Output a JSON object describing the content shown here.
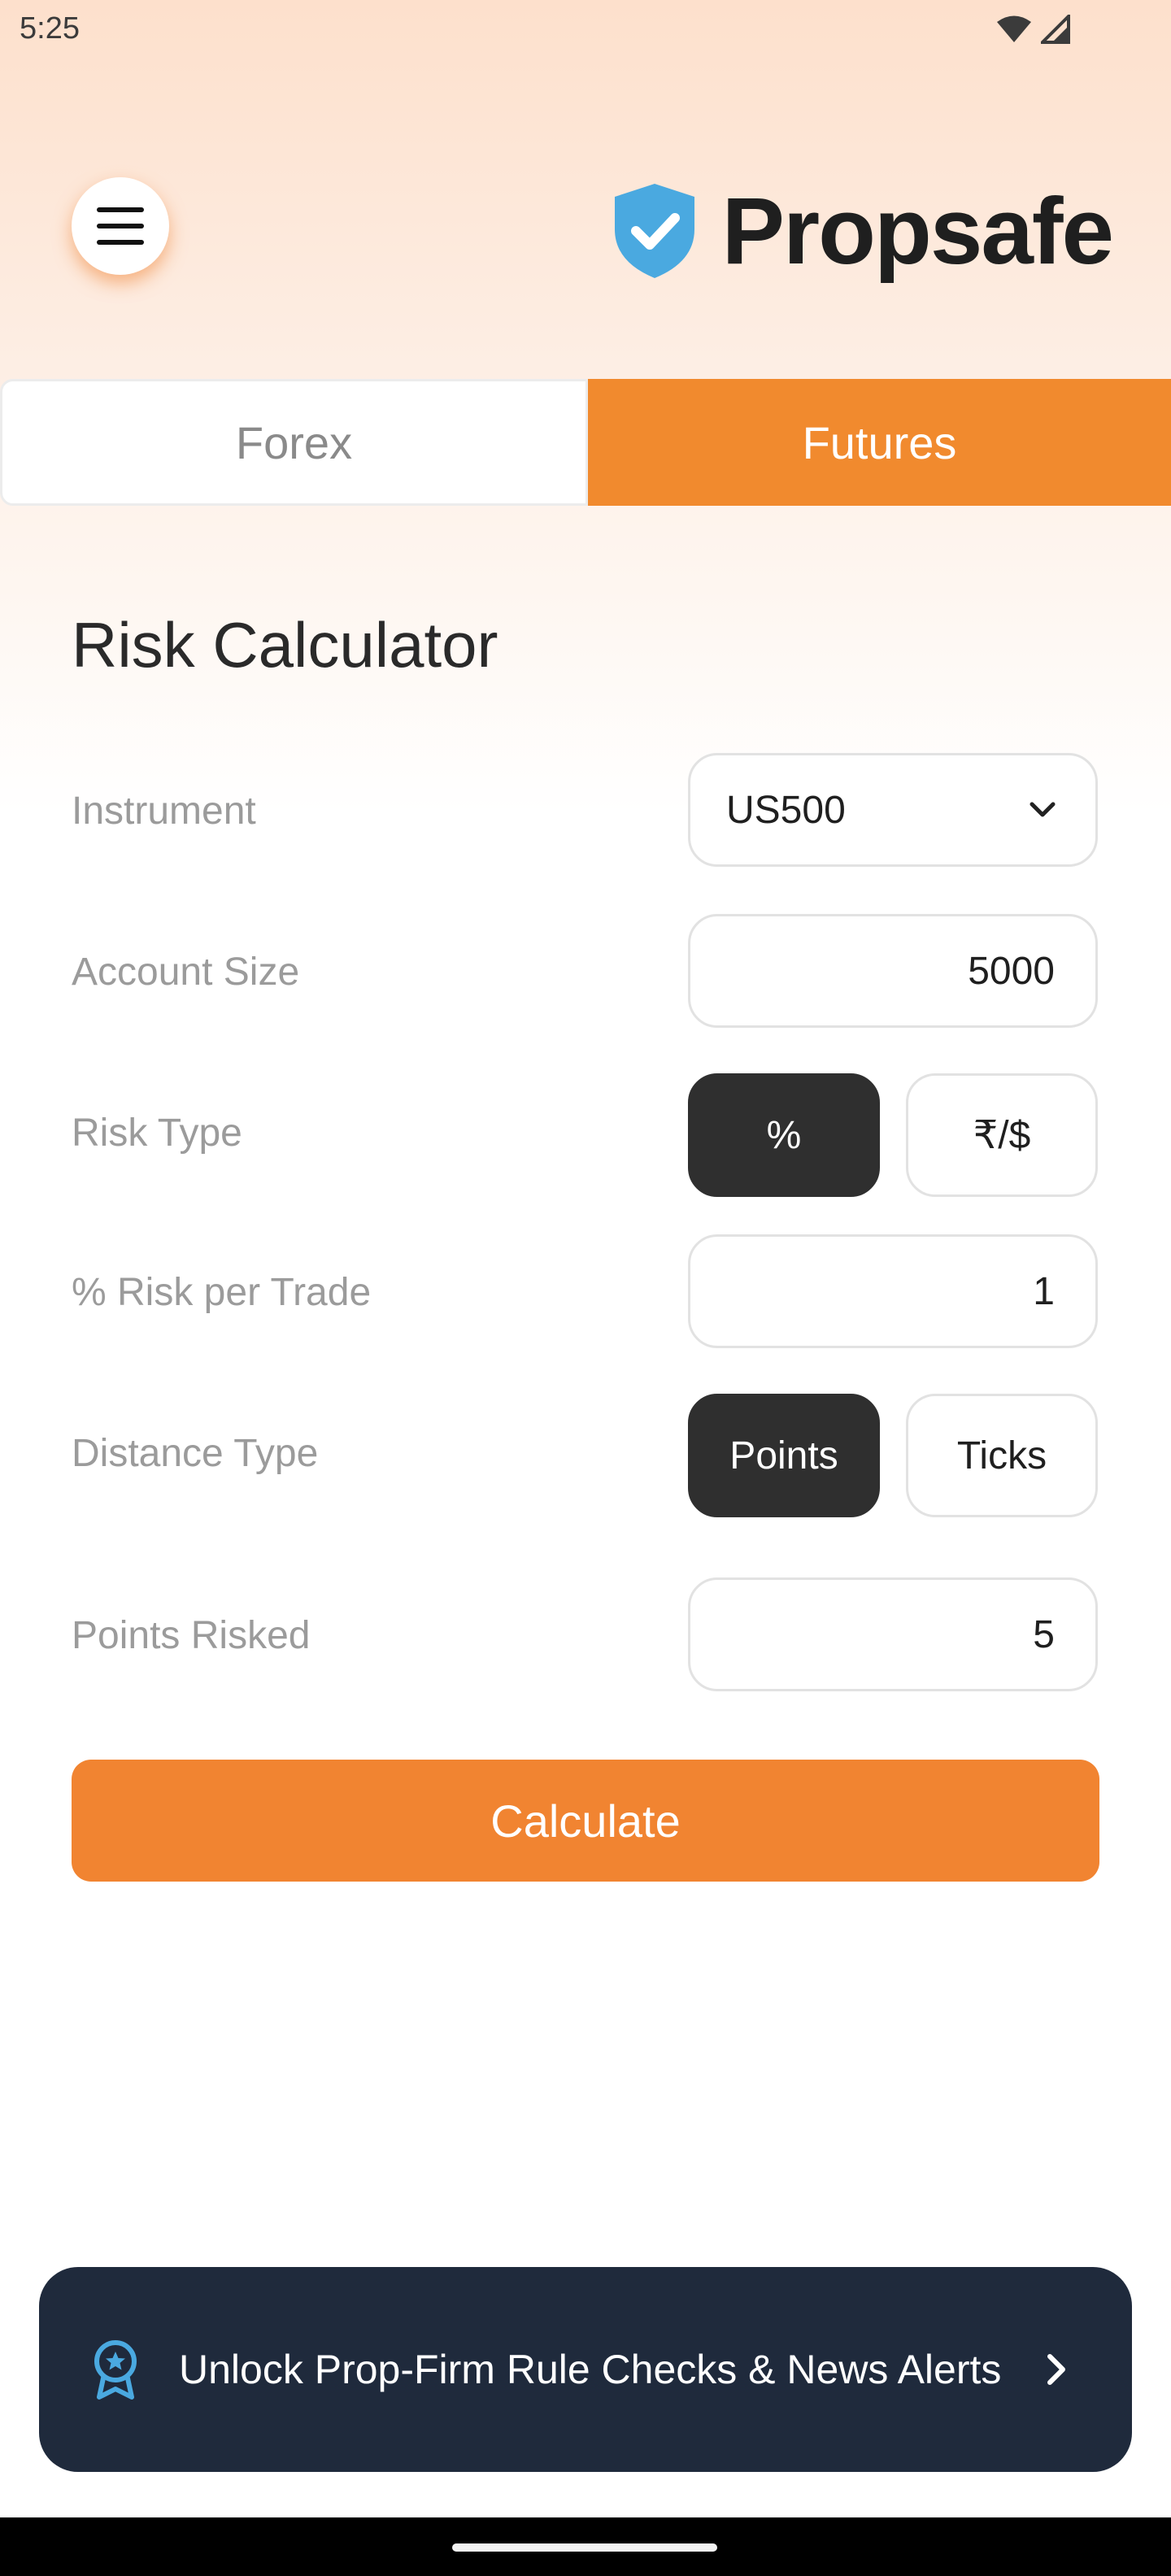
{
  "status_bar": {
    "time": "5:25",
    "icons": [
      "wifi-icon",
      "cellular-signal-icon"
    ]
  },
  "header": {
    "menu_icon": "hamburger-menu-icon",
    "brand_icon": "shield-check-icon",
    "brand_name": "Propsafe"
  },
  "tabs": [
    {
      "label": "Forex",
      "selected": false
    },
    {
      "label": "Futures",
      "selected": true
    }
  ],
  "calculator": {
    "title": "Risk Calculator",
    "instrument": {
      "label": "Instrument",
      "value": "US500"
    },
    "account_size": {
      "label": "Account Size",
      "value": "5000"
    },
    "risk_type": {
      "label": "Risk Type",
      "options": [
        "%",
        "₹/$"
      ],
      "selected": "%"
    },
    "risk_per_trade": {
      "label": "% Risk per Trade",
      "value": "1"
    },
    "distance_type": {
      "label": "Distance Type",
      "options": [
        "Points",
        "Ticks"
      ],
      "selected": "Points"
    },
    "points_risked": {
      "label": "Points Risked",
      "value": "5"
    },
    "calculate_label": "Calculate"
  },
  "banner": {
    "icon": "award-badge-icon",
    "text": "Unlock Prop-Firm Rule Checks & News Alerts",
    "arrow_icon": "chevron-right-icon"
  },
  "colors": {
    "accent": "#f18a2e",
    "dark_segment": "#2f2f2f",
    "banner_bg": "#1f2a3c",
    "brand_blue": "#4aa9e0"
  }
}
